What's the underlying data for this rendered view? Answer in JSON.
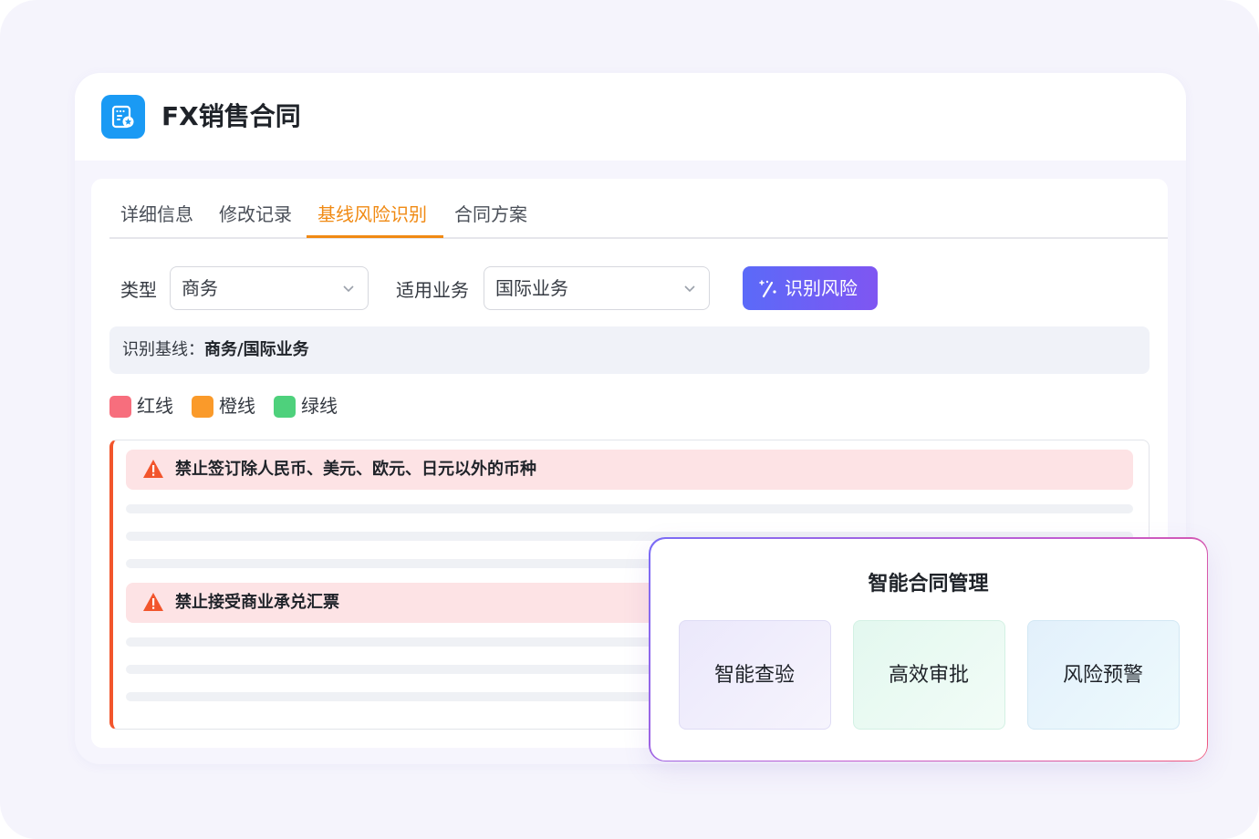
{
  "app": {
    "title": "FX销售合同",
    "icon": "contract-icon",
    "icon_color": "#1a9af4"
  },
  "tabs": [
    {
      "label": "详细信息",
      "active": false
    },
    {
      "label": "修改记录",
      "active": false
    },
    {
      "label": "基线风险识别",
      "active": true
    },
    {
      "label": "合同方案",
      "active": false
    }
  ],
  "accent_color": "#f08a14",
  "filters": {
    "type_label": "类型",
    "type_value": "商务",
    "business_label": "适用业务",
    "business_value": "国际业务"
  },
  "identify_button": {
    "label": "识别风险",
    "icon": "magic-wand-icon"
  },
  "baseline": {
    "prefix": "识别基线：",
    "value": "商务/国际业务"
  },
  "legend": [
    {
      "label": "红线",
      "color": "#f76e7d"
    },
    {
      "label": "橙线",
      "color": "#fa9a2a"
    },
    {
      "label": "绿线",
      "color": "#4ed17c"
    }
  ],
  "rules": [
    {
      "text": "禁止签订除人民币、美元、欧元、日元以外的币种",
      "level": "red"
    },
    {
      "text": "禁止接受商业承兑汇票",
      "level": "red"
    }
  ],
  "overlay": {
    "title": "智能合同管理",
    "cards": [
      {
        "label": "智能查验"
      },
      {
        "label": "高效审批"
      },
      {
        "label": "风险预警"
      }
    ]
  }
}
